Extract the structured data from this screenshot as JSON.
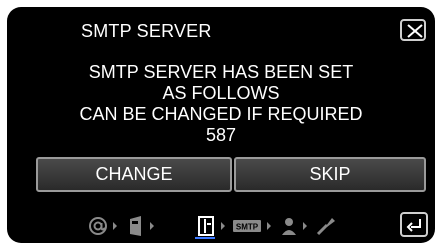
{
  "screen": {
    "title": "SMTP SERVER",
    "message_lines": [
      "SMTP SERVER HAS BEEN SET",
      "AS FOLLOWS",
      "CAN BE CHANGED IF REQUIRED",
      "587"
    ],
    "buttons": {
      "change_label": "CHANGE",
      "skip_label": "SKIP"
    },
    "steps": {
      "icons": [
        "at-sign-icon",
        "phone-icon",
        "book-icon",
        "smtp-icon",
        "person-icon",
        "wrench-icon"
      ],
      "smtp_label": "SMTP",
      "active_step": 3
    },
    "colors": {
      "accent": "#3b78ff",
      "background": "#000000",
      "text": "#ffffff"
    }
  }
}
